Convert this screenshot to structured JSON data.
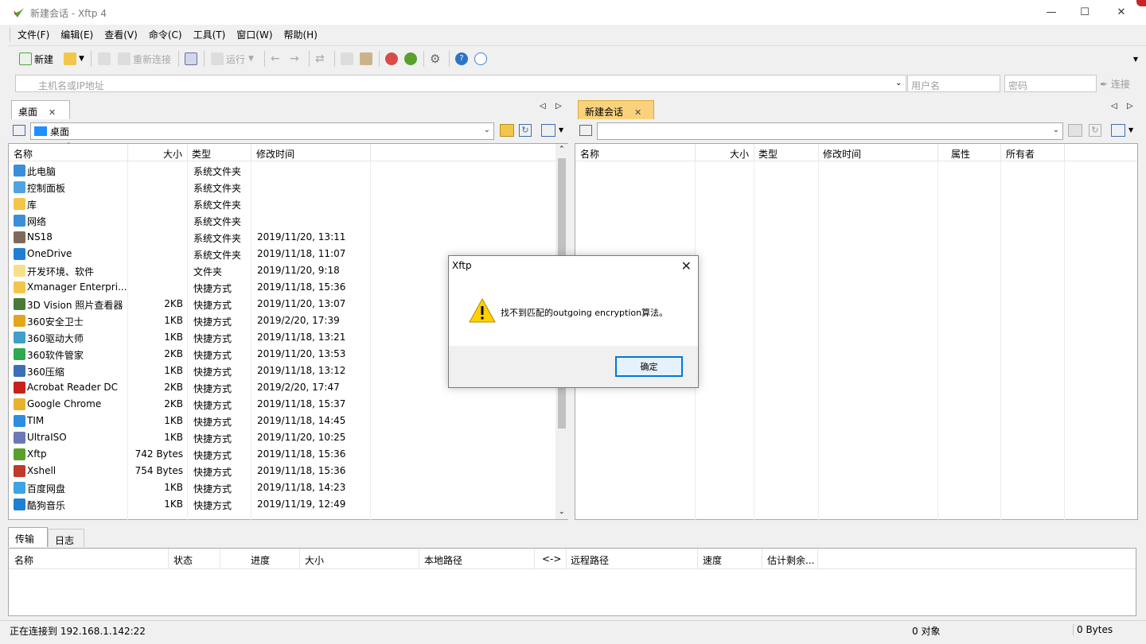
{
  "window": {
    "title": "新建会话 - Xftp 4"
  },
  "menu": [
    "文件(F)",
    "编辑(E)",
    "查看(V)",
    "命令(C)",
    "工具(T)",
    "窗口(W)",
    "帮助(H)"
  ],
  "toolbar": {
    "new_label": "新建",
    "reconnect_label": "重新连接",
    "run_label": "运行"
  },
  "address": {
    "host_placeholder": "主机名或IP地址",
    "user_placeholder": "用户名",
    "password_placeholder": "密码",
    "connect_label": "连接"
  },
  "left_pane": {
    "tab": "桌面",
    "path": "桌面",
    "columns": [
      "名称",
      "大小",
      "类型",
      "修改时间"
    ],
    "rows": [
      {
        "name": "此电脑",
        "size": "",
        "type": "系统文件夹",
        "modified": ""
      },
      {
        "name": "控制面板",
        "size": "",
        "type": "系统文件夹",
        "modified": ""
      },
      {
        "name": "库",
        "size": "",
        "type": "系统文件夹",
        "modified": ""
      },
      {
        "name": "网络",
        "size": "",
        "type": "系统文件夹",
        "modified": ""
      },
      {
        "name": "NS18",
        "size": "",
        "type": "系统文件夹",
        "modified": "2019/11/20, 13:11"
      },
      {
        "name": "OneDrive",
        "size": "",
        "type": "系统文件夹",
        "modified": "2019/11/18, 11:07"
      },
      {
        "name": "开发环境、软件",
        "size": "",
        "type": "文件夹",
        "modified": "2019/11/20, 9:18"
      },
      {
        "name": "Xmanager Enterpri...",
        "size": "",
        "type": "快捷方式",
        "modified": "2019/11/18, 15:36"
      },
      {
        "name": "3D Vision 照片查看器",
        "size": "2KB",
        "type": "快捷方式",
        "modified": "2019/11/20, 13:07"
      },
      {
        "name": "360安全卫士",
        "size": "1KB",
        "type": "快捷方式",
        "modified": "2019/2/20, 17:39"
      },
      {
        "name": "360驱动大师",
        "size": "1KB",
        "type": "快捷方式",
        "modified": "2019/11/18, 13:21"
      },
      {
        "name": "360软件管家",
        "size": "2KB",
        "type": "快捷方式",
        "modified": "2019/11/20, 13:53"
      },
      {
        "name": "360压缩",
        "size": "1KB",
        "type": "快捷方式",
        "modified": "2019/11/18, 13:12"
      },
      {
        "name": "Acrobat Reader DC",
        "size": "2KB",
        "type": "快捷方式",
        "modified": "2019/2/20, 17:47"
      },
      {
        "name": "Google Chrome",
        "size": "2KB",
        "type": "快捷方式",
        "modified": "2019/11/18, 15:37"
      },
      {
        "name": "TIM",
        "size": "1KB",
        "type": "快捷方式",
        "modified": "2019/11/18, 14:45"
      },
      {
        "name": "UltraISO",
        "size": "1KB",
        "type": "快捷方式",
        "modified": "2019/11/20, 10:25"
      },
      {
        "name": "Xftp",
        "size": "742 Bytes",
        "type": "快捷方式",
        "modified": "2019/11/18, 15:36"
      },
      {
        "name": "Xshell",
        "size": "754 Bytes",
        "type": "快捷方式",
        "modified": "2019/11/18, 15:36"
      },
      {
        "name": "百度网盘",
        "size": "1KB",
        "type": "快捷方式",
        "modified": "2019/11/18, 14:23"
      },
      {
        "name": "酷狗音乐",
        "size": "1KB",
        "type": "快捷方式",
        "modified": "2019/11/19, 12:49"
      }
    ]
  },
  "right_pane": {
    "tab": "新建会话",
    "columns": [
      "名称",
      "大小",
      "类型",
      "修改时间",
      "属性",
      "所有者"
    ]
  },
  "bottom": {
    "tabs": [
      "传输",
      "日志"
    ],
    "columns": [
      "名称",
      "状态",
      "进度",
      "大小",
      "本地路径",
      "<->",
      "远程路径",
      "速度",
      "估计剩余..."
    ]
  },
  "status": {
    "message": "正在连接到 192.168.1.142:22",
    "objects": "0 对象",
    "bytes": "0 Bytes"
  },
  "dialog": {
    "title": "Xftp",
    "message": "找不到匹配的outgoing encryption算法。",
    "ok_label": "确定"
  },
  "colors": {
    "active_tab": "#fbd27c",
    "accent": "#0078d7",
    "warning": "#ffd200"
  }
}
